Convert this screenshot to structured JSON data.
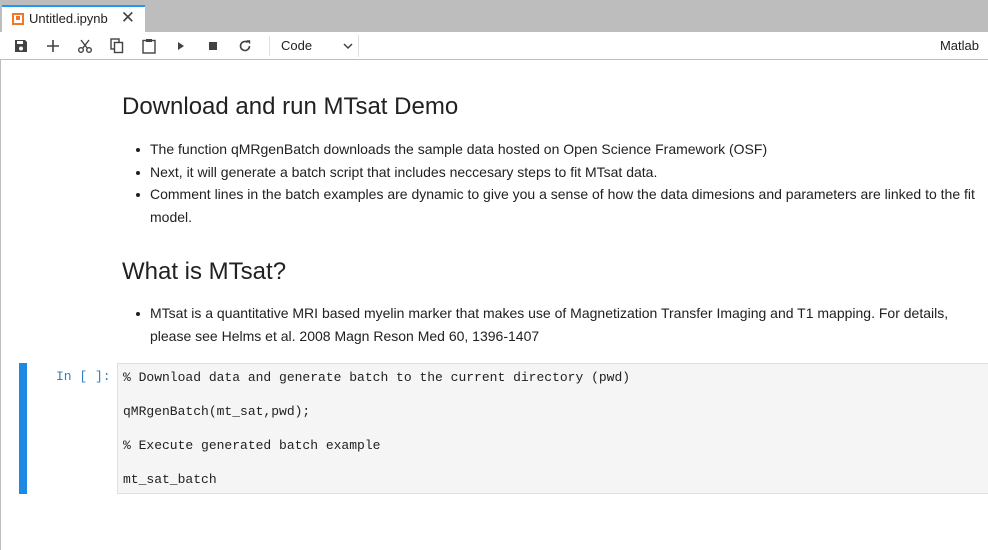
{
  "tab": {
    "title": "Untitled.ipynb",
    "close_glyph": "✕",
    "icon": "notebook-icon"
  },
  "toolbar": {
    "buttons": [
      "save-icon",
      "add-cell-icon",
      "cut-icon",
      "copy-icon",
      "paste-icon",
      "run-icon",
      "stop-icon",
      "restart-icon"
    ],
    "cell_type": "Code",
    "kernel": "Matlab"
  },
  "markdown": {
    "heading1": "Download and run MTsat Demo",
    "bullets1": [
      "The function qMRgenBatch downloads the sample data hosted on Open Science Framework (OSF)",
      "Next, it will generate a batch script that includes neccesary steps to fit MTsat data.",
      "Comment lines in the batch examples are dynamic to give you a sense of how the data dimesions and parameters are linked to the fit model."
    ],
    "heading2": "What is MTsat?",
    "bullets2": [
      "MTsat is a quantitative MRI based myelin marker that makes use of Magnetization Transfer Imaging and T1 mapping. For details, please see Helms et al. 2008 Magn Reson Med 60, 1396-1407"
    ]
  },
  "code_cell": {
    "prompt": "In [ ]:",
    "lines": [
      "% Download data and generate batch to the current directory (pwd)",
      "qMRgenBatch(mt_sat,pwd);",
      "% Execute generated batch example",
      "mt_sat_batch"
    ]
  },
  "colors": {
    "accent": "#2196f3",
    "notebook_icon": "#f37726",
    "prompt": "#307fc1",
    "collapser": "#1e88e5"
  }
}
